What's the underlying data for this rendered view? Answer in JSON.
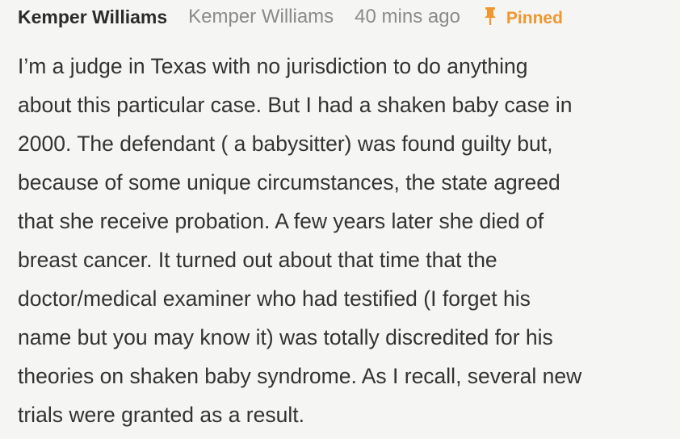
{
  "comment": {
    "author": "Kemper Williams",
    "handle": "Kemper Williams",
    "timestamp": "40 mins ago",
    "pinned_label": "Pinned",
    "pin_icon": "pin-icon",
    "accent_color": "#f0962f",
    "body_lines": [
      "I’m a judge in Texas with no jurisdiction to do anything",
      "about this particular case. But I had a shaken baby case in",
      "2000. The defendant ( a babysitter) was found guilty but,",
      "because of some unique circumstances, the state agreed",
      "that she receive probation. A few years later she died of",
      "breast cancer. It turned out about that time that the",
      "doctor/medical examiner who had testified (I forget his",
      "name but you may know it) was totally discredited for his",
      "theories on shaken baby syndrome. As I recall, several new",
      "trials were granted as a result."
    ]
  }
}
